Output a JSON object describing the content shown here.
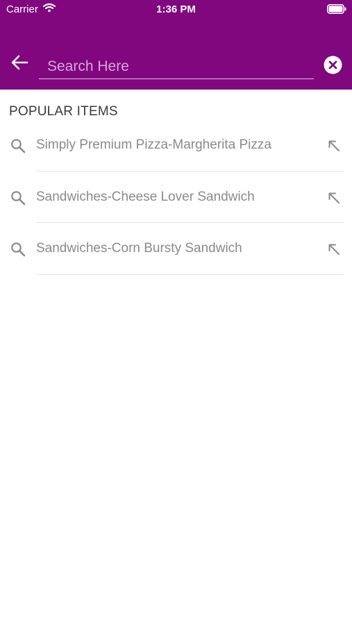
{
  "status_bar": {
    "carrier": "Carrier",
    "time": "1:36 PM"
  },
  "search": {
    "placeholder": "Search Here",
    "value": ""
  },
  "section": {
    "title": "POPULAR ITEMS"
  },
  "popular_items": [
    {
      "label": "Simply Premium Pizza-Margherita Pizza"
    },
    {
      "label": "Sandwiches-Cheese Lover Sandwich"
    },
    {
      "label": "Sandwiches-Corn Bursty Sandwich"
    }
  ],
  "icons": {
    "back": "back-arrow-icon",
    "clear": "clear-search-icon",
    "item_search": "search-icon",
    "item_fill": "arrow-up-left-icon"
  },
  "colors": {
    "header_bg": "#80077e",
    "placeholder": "#d9a6d8",
    "item_text": "#8a8a8a"
  }
}
